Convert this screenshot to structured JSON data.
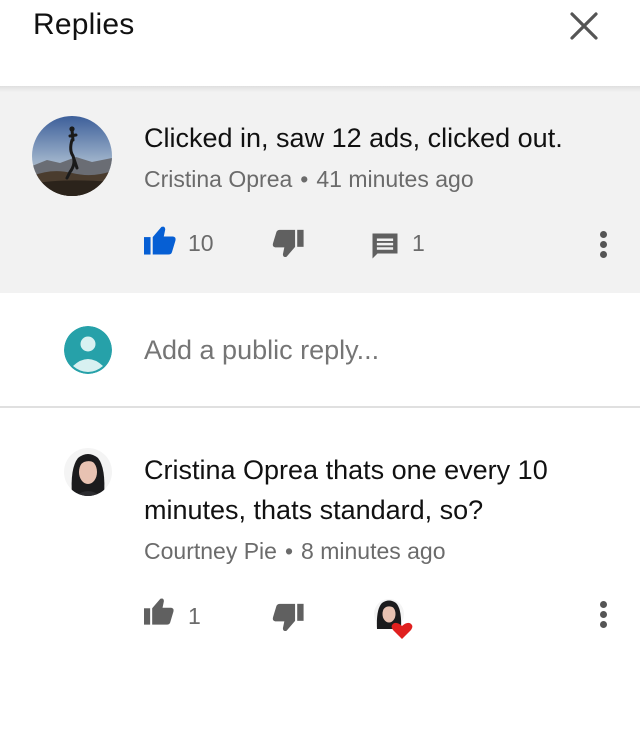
{
  "header": {
    "title": "Replies",
    "close_icon": "close-icon"
  },
  "parent": {
    "text": "Clicked in, saw 12 ads, clicked out.",
    "author": "Cristina Oprea",
    "separator": "•",
    "time": "41 minutes ago",
    "likes": "10",
    "replies": "1",
    "like_color": "#065fd4"
  },
  "add_reply": {
    "placeholder": "Add a public reply..."
  },
  "reply": {
    "text_line1": "Cristina Oprea thats one every 10",
    "text_line2": "minutes, thats standard, so?",
    "author": "Courtney Pie",
    "separator": "•",
    "time": "8 minutes ago",
    "likes": "1",
    "heart_color": "#e0201f"
  },
  "colors": {
    "muted_text": "#6b6b6b",
    "parent_bg": "#f2f2f2",
    "divider": "#e0e0e0"
  }
}
